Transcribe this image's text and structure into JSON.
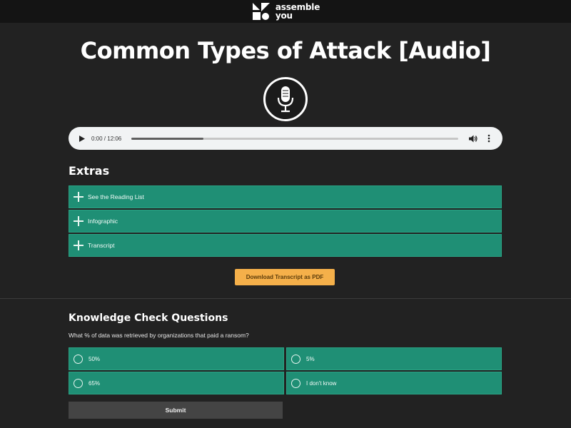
{
  "brand": {
    "line1": "assemble",
    "line2": "you"
  },
  "page_title": "Common Types of Attack [Audio]",
  "audio": {
    "time": "0:00 / 12:06",
    "progress": 0.22
  },
  "extras": {
    "heading": "Extras",
    "items": [
      {
        "label": "See the Reading List"
      },
      {
        "label": "Infographic"
      },
      {
        "label": "Transcript"
      }
    ],
    "download_label": "Download Transcript as PDF"
  },
  "knowledge_check": {
    "heading": "Knowledge Check Questions",
    "question": "What % of data was retrieved by organizations that paid a ransom?",
    "options": [
      {
        "label": "50%"
      },
      {
        "label": "5%"
      },
      {
        "label": "65%"
      },
      {
        "label": "I don't know"
      }
    ],
    "submit_label": "Submit"
  },
  "colors": {
    "background": "#222222",
    "topbar": "#141414",
    "accordion": "#1f8f75",
    "download_button": "#f5b04a",
    "submit_button": "#444444",
    "wave_start": "#34e0c8",
    "wave_end": "#4a3ae0"
  },
  "icons": {
    "brand": "assembleyou-logo-icon",
    "mic": "microphone-icon",
    "play": "play-icon",
    "volume": "volume-icon",
    "more": "more-vertical-icon",
    "expand": "plus-icon",
    "radio": "radio-empty-icon"
  }
}
